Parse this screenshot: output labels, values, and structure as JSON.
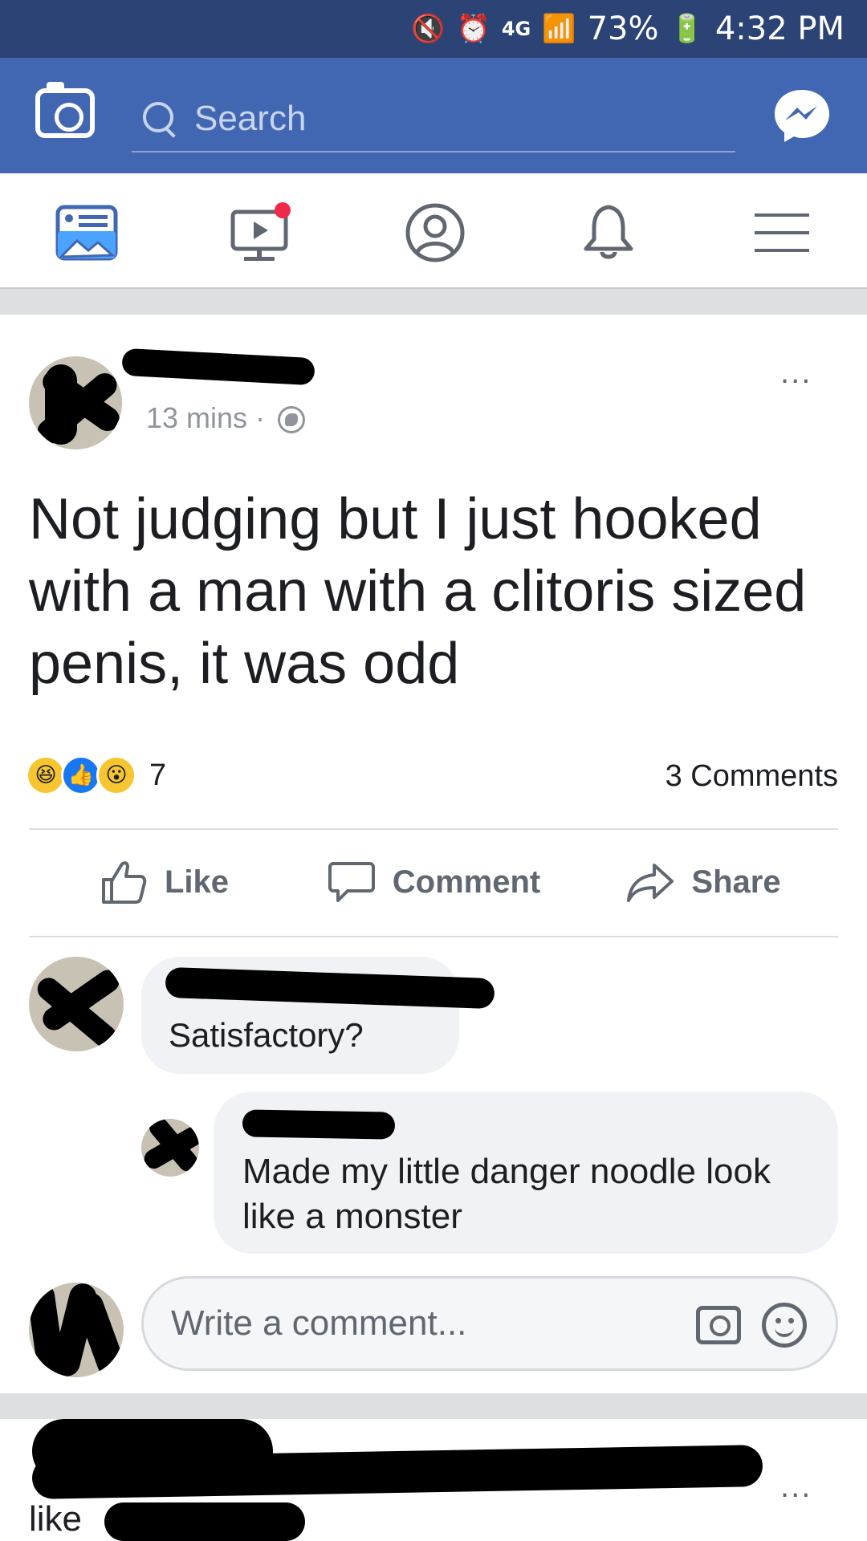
{
  "status_bar": {
    "network": "4G",
    "battery": "73%",
    "time": "4:32 PM"
  },
  "app_bar": {
    "search_placeholder": "Search"
  },
  "post": {
    "time": "13 mins",
    "separator": "·",
    "more_label": "...",
    "text": "Not judging but I just hooked with a man with a clitoris sized penis, it was odd",
    "reaction_count": "7",
    "comments_count": "3 Comments",
    "actions": {
      "like": "Like",
      "comment": "Comment",
      "share": "Share"
    }
  },
  "comments": [
    {
      "text": "Satisfactory?"
    },
    {
      "text": "Made my little danger noodle look like a monster"
    }
  ],
  "write_comment": {
    "placeholder": "Write a comment..."
  },
  "next_story": {
    "visible_text": "like",
    "more_label": "..."
  },
  "colors": {
    "brand_blue": "#4267b2",
    "status_bar": "#2c4475",
    "like_blue": "#1877f2",
    "notification_dot": "#f02849"
  }
}
